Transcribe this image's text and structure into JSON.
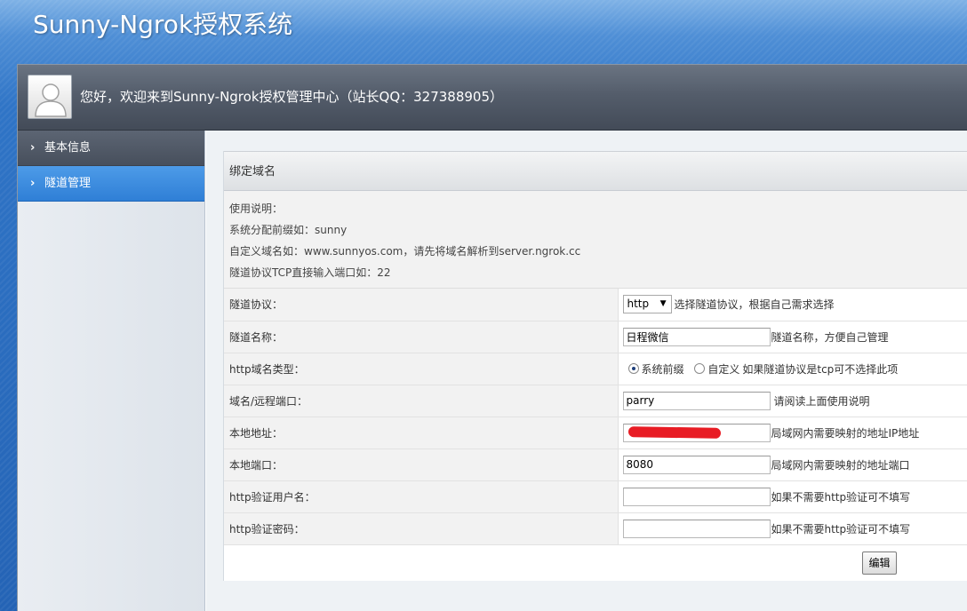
{
  "site": {
    "title": "Sunny-Ngrok授权系统"
  },
  "header": {
    "welcome": "您好，欢迎来到Sunny-Ngrok授权管理中心（站长QQ：327388905）"
  },
  "sidebar": {
    "items": [
      {
        "label": "基本信息",
        "active": false
      },
      {
        "label": "隧道管理",
        "active": true
      }
    ]
  },
  "panel": {
    "title": "绑定域名",
    "instructions": [
      "使用说明：",
      "系统分配前缀如：sunny",
      "自定义域名如：www.sunnyos.com，请先将域名解析到server.ngrok.cc",
      "隧道协议TCP直接输入端口如：22"
    ]
  },
  "form": {
    "protocol": {
      "label": "隧道协议：",
      "value": "http",
      "hint": "选择隧道协议，根据自己需求选择"
    },
    "name": {
      "label": "隧道名称：",
      "value": "日程微信",
      "hint": "隧道名称，方便自己管理"
    },
    "domain_type": {
      "label": "http域名类型：",
      "option1": "系统前缀",
      "option2": "自定义",
      "selected": "系统前缀",
      "hint": "如果隧道协议是tcp可不选择此项"
    },
    "remote": {
      "label": "域名/远程端口：",
      "value": "parry",
      "hint": "请阅读上面使用说明"
    },
    "local_addr": {
      "label": "本地地址：",
      "value": "",
      "hint": "局域网内需要映射的地址IP地址"
    },
    "local_port": {
      "label": "本地端口：",
      "value": "8080",
      "hint": "局域网内需要映射的地址端口"
    },
    "auth_user": {
      "label": "http验证用户名：",
      "value": "",
      "hint": "如果不需要http验证可不填写"
    },
    "auth_pass": {
      "label": "http验证密码：",
      "value": "",
      "hint": "如果不需要http验证可不填写"
    }
  },
  "buttons": {
    "edit": "编辑"
  },
  "colors": {
    "accent": "#2f7fd6",
    "redaction": "#e81c24"
  }
}
